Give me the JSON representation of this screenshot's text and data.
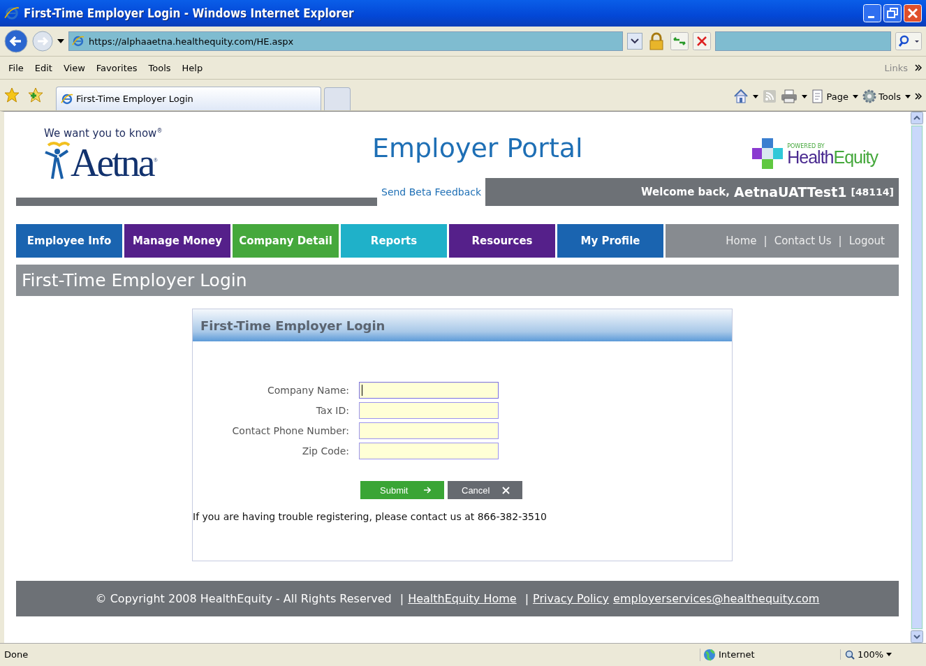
{
  "window": {
    "title": "First-Time Employer Login - Windows Internet Explorer"
  },
  "address_bar": {
    "url": "https://alphaaetna.healthequity.com/HE.aspx"
  },
  "menu_bar": {
    "items": [
      "File",
      "Edit",
      "View",
      "Favorites",
      "Tools",
      "Help"
    ],
    "links": "Links"
  },
  "tabs": [
    {
      "label": "First-Time Employer Login",
      "selected": true
    }
  ],
  "command_bar": {
    "items": [
      "Page",
      "Tools"
    ]
  },
  "header": {
    "tagline": "We want you to know$^{®}$",
    "logo": "Aetna$^{®}$",
    "portal_title": "Employer Portal",
    "feedback_link": "Send Beta Feedback",
    "powered_by": "POWERED BY",
    "brand_first": "Health",
    "brand_second": "Equity",
    "welcome": "Welcome back,",
    "user": "AetnaUATTest1",
    "user_id": "[48114]"
  },
  "nav": {
    "tabs": [
      {
        "label": "Employee Info",
        "color": "#1a64b0"
      },
      {
        "label": "Manage Money",
        "color": "#55208a"
      },
      {
        "label": "Company Detail",
        "color": "#45a83c"
      },
      {
        "label": "Reports",
        "color": "#1fb1c9"
      },
      {
        "label": "Resources",
        "color": "#55208a"
      },
      {
        "label": "My Profile",
        "color": "#1a64b0"
      }
    ],
    "links": [
      "Home",
      "Contact Us",
      "Logout"
    ],
    "separators": [
      "|",
      "|"
    ]
  },
  "page_title": "First-Time Employer Login",
  "form": {
    "title": "First-Time Employer Login",
    "fields": [
      {
        "label": "Company Name:",
        "focused": true
      },
      {
        "label": "Tax ID:",
        "focused": false
      },
      {
        "label": "Contact Phone Number:",
        "focused": false
      },
      {
        "label": "Zip Code:",
        "focused": false
      }
    ],
    "buttons": [
      {
        "label": "Submit",
        "kind": "submit"
      },
      {
        "label": "Cancel",
        "kind": "cancel"
      }
    ],
    "help": "If you are having trouble registering, please contact us at 866-382-3510"
  },
  "footer": {
    "copyright": "© Copyright 2008 HealthEquity - All Rights Reserved",
    "links": [
      "HealthEquity Home",
      "Privacy Policy",
      "employerservices@healthequity.com"
    ],
    "separators": [
      "|",
      "|"
    ]
  },
  "status_bar": {
    "status": "Done",
    "zone": "Internet",
    "zoom": "100%"
  }
}
